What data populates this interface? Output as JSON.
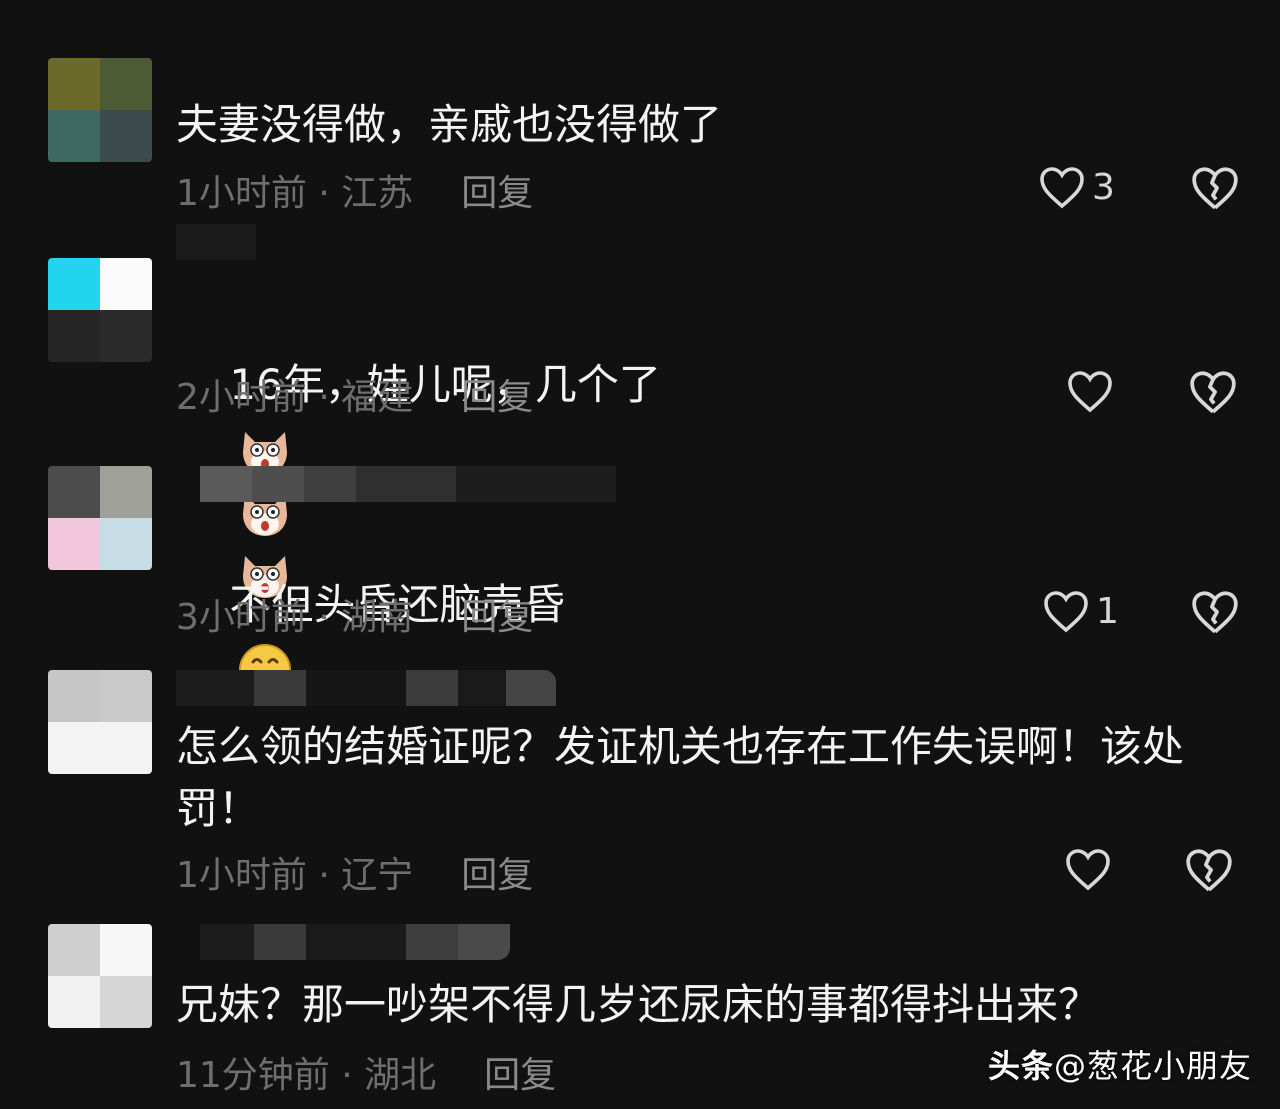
{
  "comments": [
    {
      "text": "夫妻没得做，亲戚也没得做了",
      "time_location": "1小时前 · 江苏",
      "reply_label": "回复",
      "like_count": "3",
      "avatar_colors": [
        "#6b6a2a",
        "#4d5a36",
        "#3f6962",
        "#3c4c4c"
      ]
    },
    {
      "text": "16年，娃儿呢，几个了",
      "time_location": "2小时前 · 福建",
      "reply_label": "回复",
      "like_count": "",
      "emojis": [
        "surprised-dog-emoji",
        "surprised-dog-emoji",
        "surprised-dog-emoji"
      ],
      "avatar_colors": [
        "#22d4f0",
        "#fafafa",
        "#262626",
        "#2b2b2b"
      ]
    },
    {
      "text": "不但头昏还脑壳昏",
      "time_location": "3小时前 · 湖南",
      "reply_label": "回复",
      "like_count": "1",
      "emojis": [
        "grinning-face-emoji"
      ],
      "avatar_colors": [
        "#4c4c4c",
        "#9fa097",
        "#f2c6dc",
        "#c6dde6"
      ]
    },
    {
      "text": "怎么领的结婚证呢？发证机关也存在工作失误啊！该处罚！",
      "time_location": "1小时前 · 辽宁",
      "reply_label": "回复",
      "like_count": "",
      "avatar_colors": [
        "#c6c6c6",
        "#c9c9c9",
        "#f3f3f3",
        "#f3f3f3"
      ]
    },
    {
      "text": "兄妹？那一吵架不得几岁还尿床的事都得抖出来？",
      "time_location": "11分钟前 · 湖北",
      "reply_label": "回复",
      "like_count": "",
      "avatar_colors": [
        "#cfcfcf",
        "#f7f7f7",
        "#f2f2f2",
        "#d6d6d6"
      ]
    }
  ],
  "watermark": {
    "brand": "头条",
    "handle": "@葱花小朋友"
  },
  "icons": {
    "like": "heart-icon",
    "dislike": "broken-heart-icon"
  }
}
